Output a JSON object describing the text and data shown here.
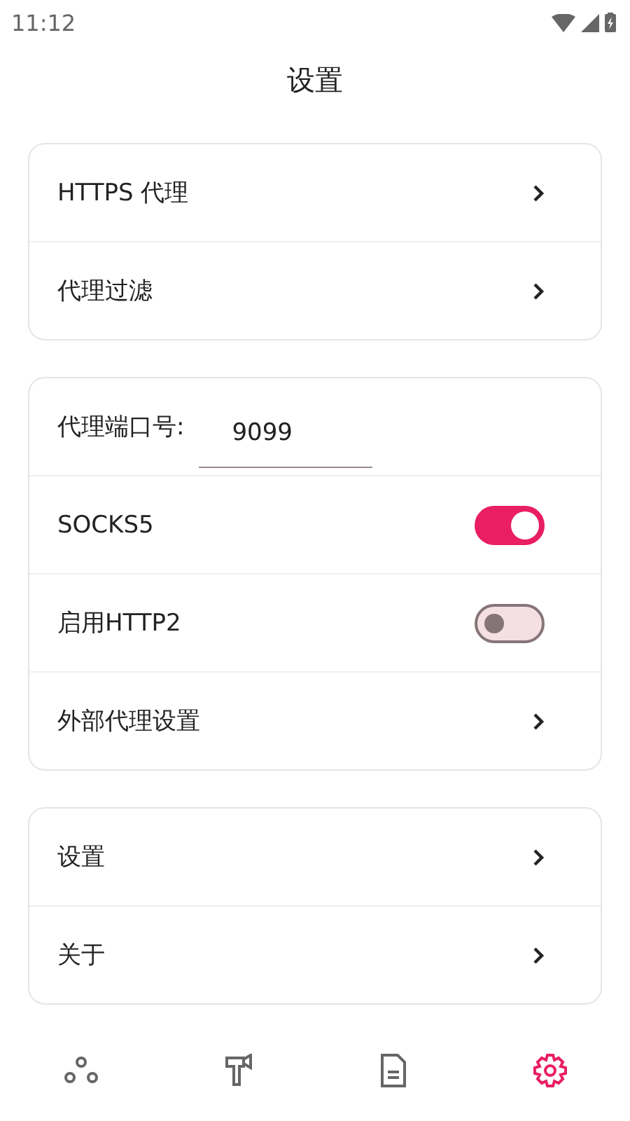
{
  "status_bar": {
    "time": "11:12"
  },
  "title": "设置",
  "groups": [
    {
      "items": [
        {
          "kind": "link",
          "label": "HTTPS 代理"
        },
        {
          "kind": "link",
          "label": "代理过滤"
        }
      ]
    },
    {
      "items": [
        {
          "kind": "input",
          "label": "代理端口号:",
          "value": "9099"
        },
        {
          "kind": "switch",
          "label": "SOCKS5",
          "on": true
        },
        {
          "kind": "switch",
          "label": "启用HTTP2",
          "on": false
        },
        {
          "kind": "link",
          "label": "外部代理设置"
        }
      ]
    },
    {
      "items": [
        {
          "kind": "link",
          "label": "设置"
        },
        {
          "kind": "link",
          "label": "关于"
        }
      ]
    }
  ],
  "nav": [
    {
      "selected": false
    },
    {
      "selected": false
    },
    {
      "selected": false
    },
    {
      "selected": true
    }
  ]
}
